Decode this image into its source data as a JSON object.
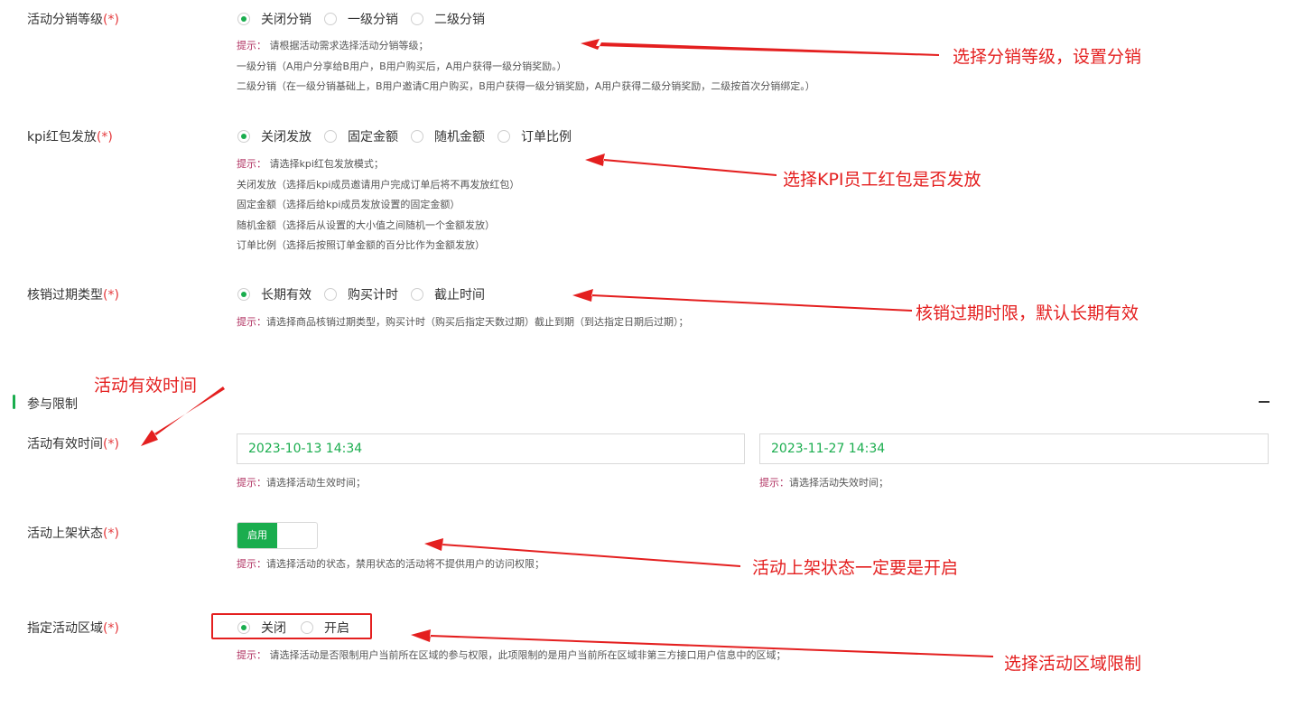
{
  "distribution": {
    "label": "活动分销等级",
    "required_mark": "(*)",
    "options": [
      "关闭分销",
      "一级分销",
      "二级分销"
    ],
    "selected": 0,
    "hint_prefix": "提示：",
    "hint_lines": [
      "请根据活动需求选择活动分销等级；",
      "一级分销（A用户分享给B用户，B用户购买后，A用户获得一级分销奖励。）",
      "二级分销（在一级分销基础上，B用户邀请C用户购买，B用户获得一级分销奖励，A用户获得二级分销奖励，二级按首次分销绑定。）"
    ]
  },
  "kpi": {
    "label": "kpi红包发放",
    "required_mark": "(*)",
    "options": [
      "关闭发放",
      "固定金额",
      "随机金额",
      "订单比例"
    ],
    "selected": 0,
    "hint_prefix": "提示：",
    "hint_lines": [
      "请选择kpi红包发放模式；",
      "关闭发放（选择后kpi成员邀请用户完成订单后将不再发放红包）",
      "固定金额（选择后给kpi成员发放设置的固定金额）",
      "随机金额（选择后从设置的大小值之间随机一个金额发放）",
      "订单比例（选择后按照订单金额的百分比作为金额发放）"
    ]
  },
  "expiry": {
    "label": "核销过期类型",
    "required_mark": "(*)",
    "options": [
      "长期有效",
      "购买计时",
      "截止时间"
    ],
    "selected": 0,
    "hint_prefix": "提示：",
    "hint": "请选择商品核销过期类型，购买计时（购买后指定天数过期）截止到期（到达指定日期后过期）；"
  },
  "section": {
    "title": "参与限制"
  },
  "valid_time": {
    "label": "活动有效时间",
    "required_mark": "(*)",
    "start_value": "2023-10-13 14:34",
    "end_value": "2023-11-27 14:34",
    "hint_prefix": "提示：",
    "start_hint": "请选择活动生效时间；",
    "end_hint": "请选择活动失效时间；"
  },
  "listing": {
    "label": "活动上架状态",
    "required_mark": "(*)",
    "toggle_label": "启用",
    "hint_prefix": "提示：",
    "hint": "请选择活动的状态，禁用状态的活动将不提供用户的访问权限；"
  },
  "region": {
    "label": "指定活动区域",
    "required_mark": "(*)",
    "options": [
      "关闭",
      "开启"
    ],
    "selected": 0,
    "hint_prefix": "提示：",
    "hint": "请选择活动是否限制用户当前所在区域的参与权限，此项限制的是用户当前所在区域非第三方接口用户信息中的区域；"
  },
  "annotations": {
    "distribution": "选择分销等级，设置分销",
    "kpi": "选择KPI员工红包是否发放",
    "expiry": "核销过期时限，默认长期有效",
    "valid_time": "活动有效时间",
    "listing": "活动上架状态一定要是开启",
    "region": "选择活动区域限制"
  },
  "colors": {
    "accent": "#1aad4e",
    "annotation": "#e41f1f",
    "required": "#e4393c"
  }
}
